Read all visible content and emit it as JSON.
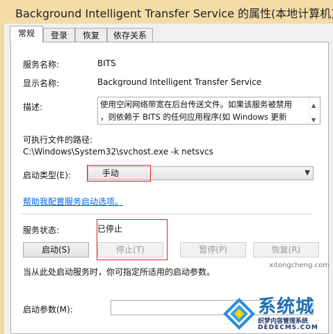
{
  "window": {
    "title": "Background Intelligent Transfer Service 的属性(本地计算机)"
  },
  "tabs": [
    {
      "label": "常规",
      "active": true
    },
    {
      "label": "登录",
      "active": false
    },
    {
      "label": "恢复",
      "active": false
    },
    {
      "label": "依存关系",
      "active": false
    }
  ],
  "general": {
    "service_name_label": "服务名称:",
    "service_name_value": "BITS",
    "display_name_label": "显示名称:",
    "display_name_value": "Background Intelligent Transfer Service",
    "description_label": "描述:",
    "description_line1": "使用空闲网络带宽在后台传送文件。如果该服务被禁用",
    "description_line2": "，则依赖于 BITS 的任何应用程序(如 Windows 更新",
    "exe_path_label": "可执行文件的路径:",
    "exe_path_value": "C:\\Windows\\System32\\svchost.exe -k netsvcs",
    "startup_type_label": "启动类型(E):",
    "startup_type_value": "手动",
    "help_link": "帮助我配置服务启动选项。",
    "status_label": "服务状态:",
    "status_value": "已停止",
    "start_hint": "当从此处启动服务时，你可指定所适用的启动参数。",
    "start_params_label": "启动参数(M):",
    "start_params_value": ""
  },
  "buttons": {
    "start": "启动(S)",
    "stop": "停止(T)",
    "pause": "暂停(P)",
    "resume": "恢复(R)"
  },
  "watermark": {
    "brand": "系统城",
    "subtitle": "织梦内容管理系统",
    "url": "DEDECMS.COM",
    "corner": "xitongcheng.com"
  },
  "colors": {
    "title_bar": "#f3dca6",
    "link": "#0066cc",
    "highlight_box": "#d9252a"
  }
}
